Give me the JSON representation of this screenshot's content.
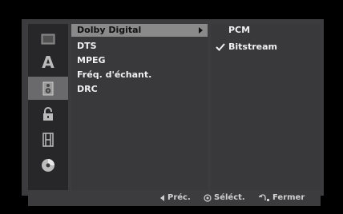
{
  "left_icons": [
    {
      "name": "disc-menu-icon",
      "active": false
    },
    {
      "name": "language-icon",
      "glyph": "A",
      "active": false
    },
    {
      "name": "speaker-icon",
      "active": true
    },
    {
      "name": "lock-icon",
      "active": false
    },
    {
      "name": "film-icon",
      "active": false
    },
    {
      "name": "disc-icon",
      "active": false
    }
  ],
  "menu": {
    "items": [
      {
        "label": "Dolby Digital",
        "selected": true
      },
      {
        "label": "DTS"
      },
      {
        "label": "MPEG"
      },
      {
        "label": "Fréq. d'échant."
      },
      {
        "label": "DRC"
      }
    ]
  },
  "options": {
    "items": [
      {
        "label": "PCM",
        "checked": false
      },
      {
        "label": "Bitstream",
        "checked": true
      }
    ]
  },
  "footer": {
    "prev_label": "Préc.",
    "select_label": "Séléct.",
    "close_label": "Fermer"
  }
}
